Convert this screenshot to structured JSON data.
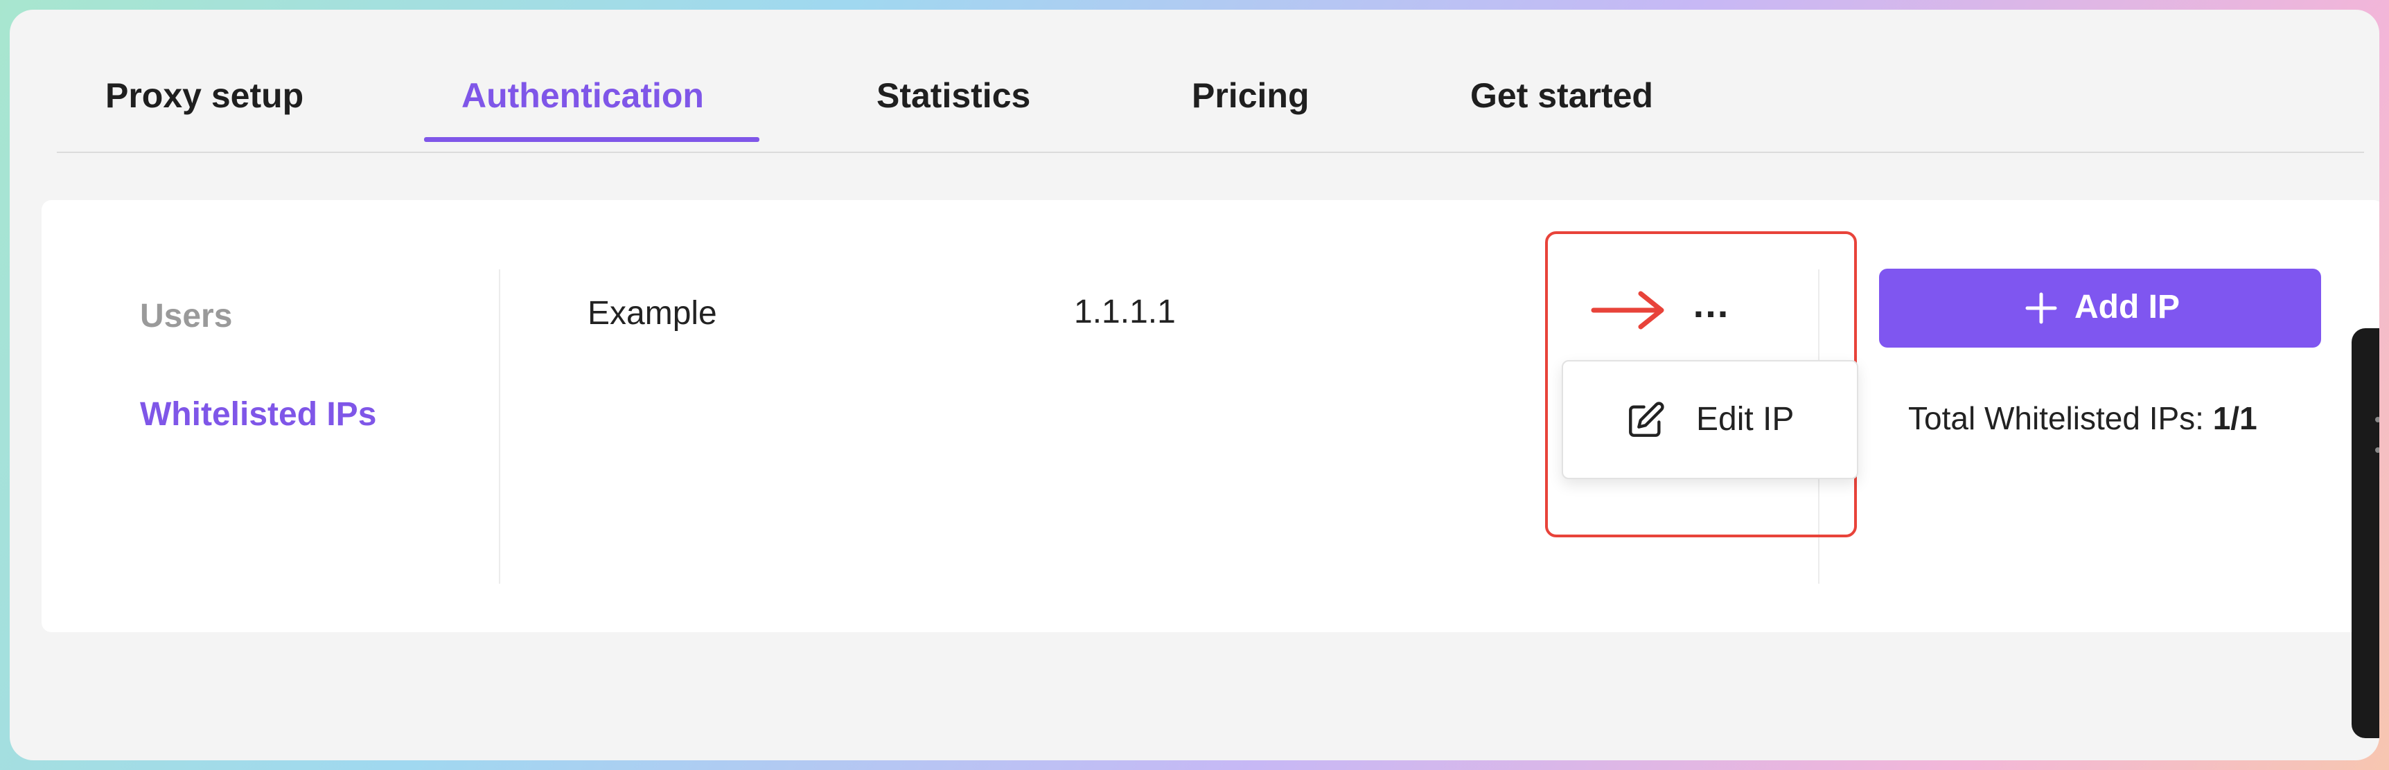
{
  "tabs": [
    {
      "label": "Proxy setup"
    },
    {
      "label": "Authentication"
    },
    {
      "label": "Statistics"
    },
    {
      "label": "Pricing"
    },
    {
      "label": "Get started"
    }
  ],
  "active_tab": "Authentication",
  "sidebar": {
    "items": [
      {
        "label": "Users",
        "state": "inactive"
      },
      {
        "label": "Whitelisted IPs",
        "state": "active"
      }
    ]
  },
  "row": {
    "name": "Example",
    "ip": "1.1.1.1",
    "more_label": "..."
  },
  "menu": {
    "items": [
      {
        "label": "Edit IP",
        "icon": "edit-icon"
      }
    ]
  },
  "actions": {
    "add_ip_label": "Add IP",
    "add_icon": "plus-icon"
  },
  "summary": {
    "label": "Total Whitelisted IPs:",
    "value": "1/1"
  },
  "colors": {
    "accent": "#7f56e8",
    "highlight": "#e8433a",
    "inactive_text": "#9a9a9a"
  }
}
